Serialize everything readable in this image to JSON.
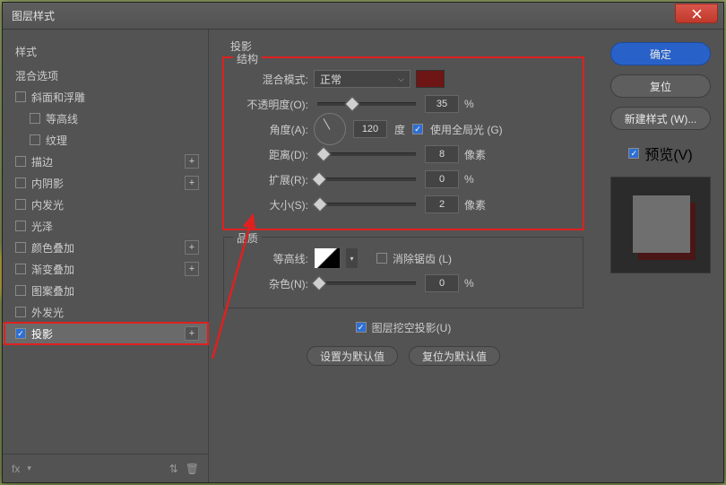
{
  "title": "图层样式",
  "sidebar": {
    "header": "样式",
    "blendOptions": "混合选项",
    "items": [
      {
        "label": "斜面和浮雕",
        "checked": false,
        "plus": false
      },
      {
        "label": "等高线",
        "checked": false,
        "plus": false,
        "sub": true
      },
      {
        "label": "纹理",
        "checked": false,
        "plus": false,
        "sub": true
      },
      {
        "label": "描边",
        "checked": false,
        "plus": true
      },
      {
        "label": "内阴影",
        "checked": false,
        "plus": true
      },
      {
        "label": "内发光",
        "checked": false,
        "plus": false
      },
      {
        "label": "光泽",
        "checked": false,
        "plus": false
      },
      {
        "label": "颜色叠加",
        "checked": false,
        "plus": true
      },
      {
        "label": "渐变叠加",
        "checked": false,
        "plus": true
      },
      {
        "label": "图案叠加",
        "checked": false,
        "plus": false
      },
      {
        "label": "外发光",
        "checked": false,
        "plus": false
      },
      {
        "label": "投影",
        "checked": true,
        "plus": true,
        "selected": true
      }
    ],
    "footer": {
      "fx": "fx",
      "upDown": "⇅",
      "trash": "🗑"
    }
  },
  "main": {
    "groupTitle": "投影",
    "structure": {
      "legend": "结构",
      "blendModeLabel": "混合模式:",
      "blendModeValue": "正常",
      "opacityLabel": "不透明度(O):",
      "opacityValue": "35",
      "opacityUnit": "%",
      "angleLabel": "角度(A):",
      "angleValue": "120",
      "angleUnit": "度",
      "globalLight": "使用全局光 (G)",
      "distanceLabel": "距离(D):",
      "distanceValue": "8",
      "distanceUnit": "像素",
      "spreadLabel": "扩展(R):",
      "spreadValue": "0",
      "spreadUnit": "%",
      "sizeLabel": "大小(S):",
      "sizeValue": "2",
      "sizeUnit": "像素",
      "swatchColor": "#6e1515"
    },
    "quality": {
      "legend": "品质",
      "contourLabel": "等高线:",
      "antiAlias": "消除锯齿 (L)",
      "noiseLabel": "杂色(N):",
      "noiseValue": "0",
      "noiseUnit": "%"
    },
    "knockout": "图层挖空投影(U)",
    "makeDefault": "设置为默认值",
    "resetDefault": "复位为默认值"
  },
  "right": {
    "ok": "确定",
    "cancel": "复位",
    "newStyle": "新建样式 (W)...",
    "previewLabel": "预览(V)"
  }
}
